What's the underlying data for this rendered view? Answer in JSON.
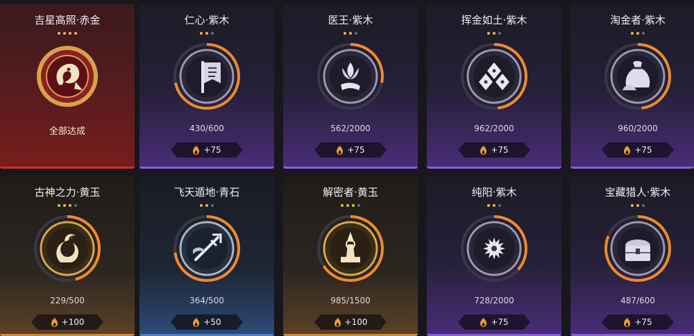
{
  "colors": {
    "progress_arc": "#f08a2a",
    "star_on": "#e8b84b",
    "star_off": "#6a6a74",
    "flame": "#f0a030"
  },
  "cards": [
    {
      "title": "吉星高照·赤金",
      "tier": "red",
      "stars_on": 4,
      "stars_total": 4,
      "completed": true,
      "status": "全部达成",
      "icon": "koi-fish-icon",
      "progress": 1.0
    },
    {
      "title": "仁心·紫木",
      "tier": "purple",
      "stars_on": 2,
      "stars_total": 3,
      "completed": false,
      "progress_text": "430/600",
      "reward": "+75",
      "icon": "banner-flag-icon",
      "progress": 0.7167
    },
    {
      "title": "医王·紫木",
      "tier": "purple",
      "stars_on": 2,
      "stars_total": 3,
      "completed": false,
      "progress_text": "562/2000",
      "reward": "+75",
      "icon": "lotus-hand-icon",
      "progress": 0.281
    },
    {
      "title": "挥金如土·紫木",
      "tier": "purple",
      "stars_on": 2,
      "stars_total": 3,
      "completed": false,
      "progress_text": "962/2000",
      "reward": "+75",
      "icon": "gold-ingots-icon",
      "progress": 0.481
    },
    {
      "title": "淘金者·紫木",
      "tier": "purple",
      "stars_on": 2,
      "stars_total": 3,
      "completed": false,
      "progress_text": "960/2000",
      "reward": "+75",
      "icon": "treasure-sack-icon",
      "progress": 0.48
    },
    {
      "title": "古神之力·黄玉",
      "tier": "gold",
      "stars_on": 3,
      "stars_total": 4,
      "completed": false,
      "progress_text": "229/500",
      "reward": "+100",
      "icon": "serpent-god-icon",
      "progress": 0.458
    },
    {
      "title": "飞天遁地·青石",
      "tier": "blue",
      "stars_on": 2,
      "stars_total": 3,
      "completed": false,
      "progress_text": "364/500",
      "reward": "+50",
      "icon": "trident-icon",
      "progress": 0.728
    },
    {
      "title": "解密者·黄玉",
      "tier": "gold",
      "stars_on": 3,
      "stars_total": 4,
      "completed": false,
      "progress_text": "985/1500",
      "reward": "+100",
      "icon": "relic-altar-icon",
      "progress": 0.6567
    },
    {
      "title": "纯阳·紫木",
      "tier": "purple",
      "stars_on": 2,
      "stars_total": 3,
      "completed": false,
      "progress_text": "728/2000",
      "reward": "+75",
      "icon": "sun-emblem-icon",
      "progress": 0.364
    },
    {
      "title": "宝藏猎人·紫木",
      "tier": "purple",
      "stars_on": 2,
      "stars_total": 3,
      "completed": false,
      "progress_text": "487/600",
      "reward": "+75",
      "icon": "treasure-chest-icon",
      "progress": 0.8117
    }
  ]
}
